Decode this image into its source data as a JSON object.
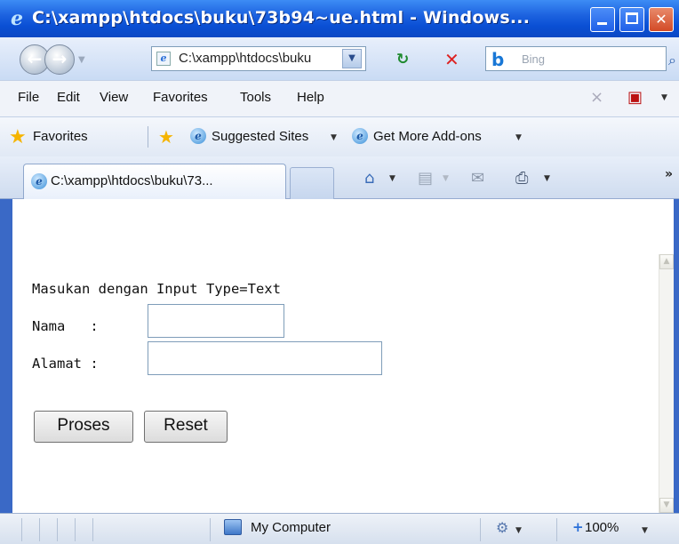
{
  "window": {
    "title": "C:\\xampp\\htdocs\\buku\\73b94~ue.html - Windows..."
  },
  "address_bar": {
    "url": "C:\\xampp\\htdocs\\buku"
  },
  "search": {
    "placeholder": "Bing"
  },
  "menu": {
    "items": [
      "File",
      "Edit",
      "View",
      "Favorites",
      "Tools",
      "Help"
    ]
  },
  "favorites_bar": {
    "label": "Favorites",
    "links": [
      "Suggested Sites",
      "Get More Add-ons"
    ]
  },
  "tab": {
    "title": "C:\\xampp\\htdocs\\buku\\73..."
  },
  "page": {
    "heading": "Masukan dengan Input Type=Text",
    "nama_label": "Nama   :",
    "alamat_label": "Alamat :",
    "nama_value": "",
    "alamat_value": "",
    "proses_label": "Proses",
    "reset_label": "Reset"
  },
  "status_bar": {
    "zone": "My Computer",
    "zoom": "100%"
  },
  "colors": {
    "titlebar": "#0a4fd4",
    "close_button": "#d34a26",
    "frame": "#3a69c6"
  },
  "icons": [
    "ie-icon",
    "back-arrow-icon",
    "forward-arrow-icon",
    "refresh-icon",
    "stop-icon",
    "bing-icon",
    "search-icon",
    "star-icon",
    "add-favorite-icon",
    "home-icon",
    "feeds-icon",
    "mail-icon",
    "print-icon",
    "computer-icon",
    "protected-mode-icon",
    "zoom-icon"
  ]
}
